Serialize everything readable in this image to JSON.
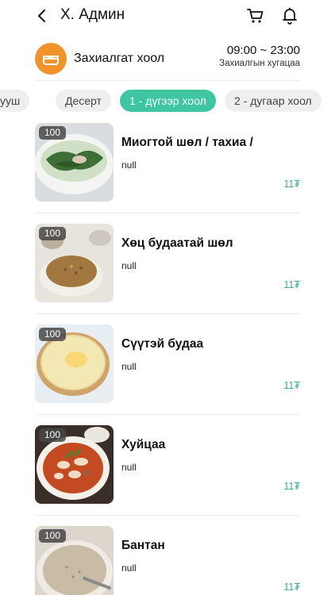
{
  "header": {
    "title": "Х. Админ"
  },
  "shop": {
    "name": "Захиалгат хоол",
    "time": "09:00 ~ 23:00",
    "hours_label": "Захиалгын хугацаа"
  },
  "tabs": [
    {
      "label": "ууш",
      "active": false
    },
    {
      "label": "Десерт",
      "active": false
    },
    {
      "label": "1 - дүгээр хоол",
      "active": true
    },
    {
      "label": "2 - дугаар хоол",
      "active": false
    }
  ],
  "items": [
    {
      "name": "Миогтой шөл / тахиа /",
      "description": "null",
      "price": "11₮",
      "badge": "100"
    },
    {
      "name": "Хөц будаатай шөл",
      "description": "null",
      "price": "11₮",
      "badge": "100"
    },
    {
      "name": "Сүүтэй будаа",
      "description": "null",
      "price": "11₮",
      "badge": "100"
    },
    {
      "name": "Хуйцаа",
      "description": "null",
      "price": "11₮",
      "badge": "100"
    },
    {
      "name": "Бантан",
      "description": "null",
      "price": "11₮",
      "badge": "100"
    }
  ],
  "icons": {
    "back": "chevron-left-icon",
    "cart": "cart-icon",
    "bell": "bell-icon",
    "shop_logo": "bowl-icon"
  },
  "colors": {
    "accent": "#3fc6a0",
    "price": "#3fa88d",
    "shop_logo": "#f0932b"
  }
}
